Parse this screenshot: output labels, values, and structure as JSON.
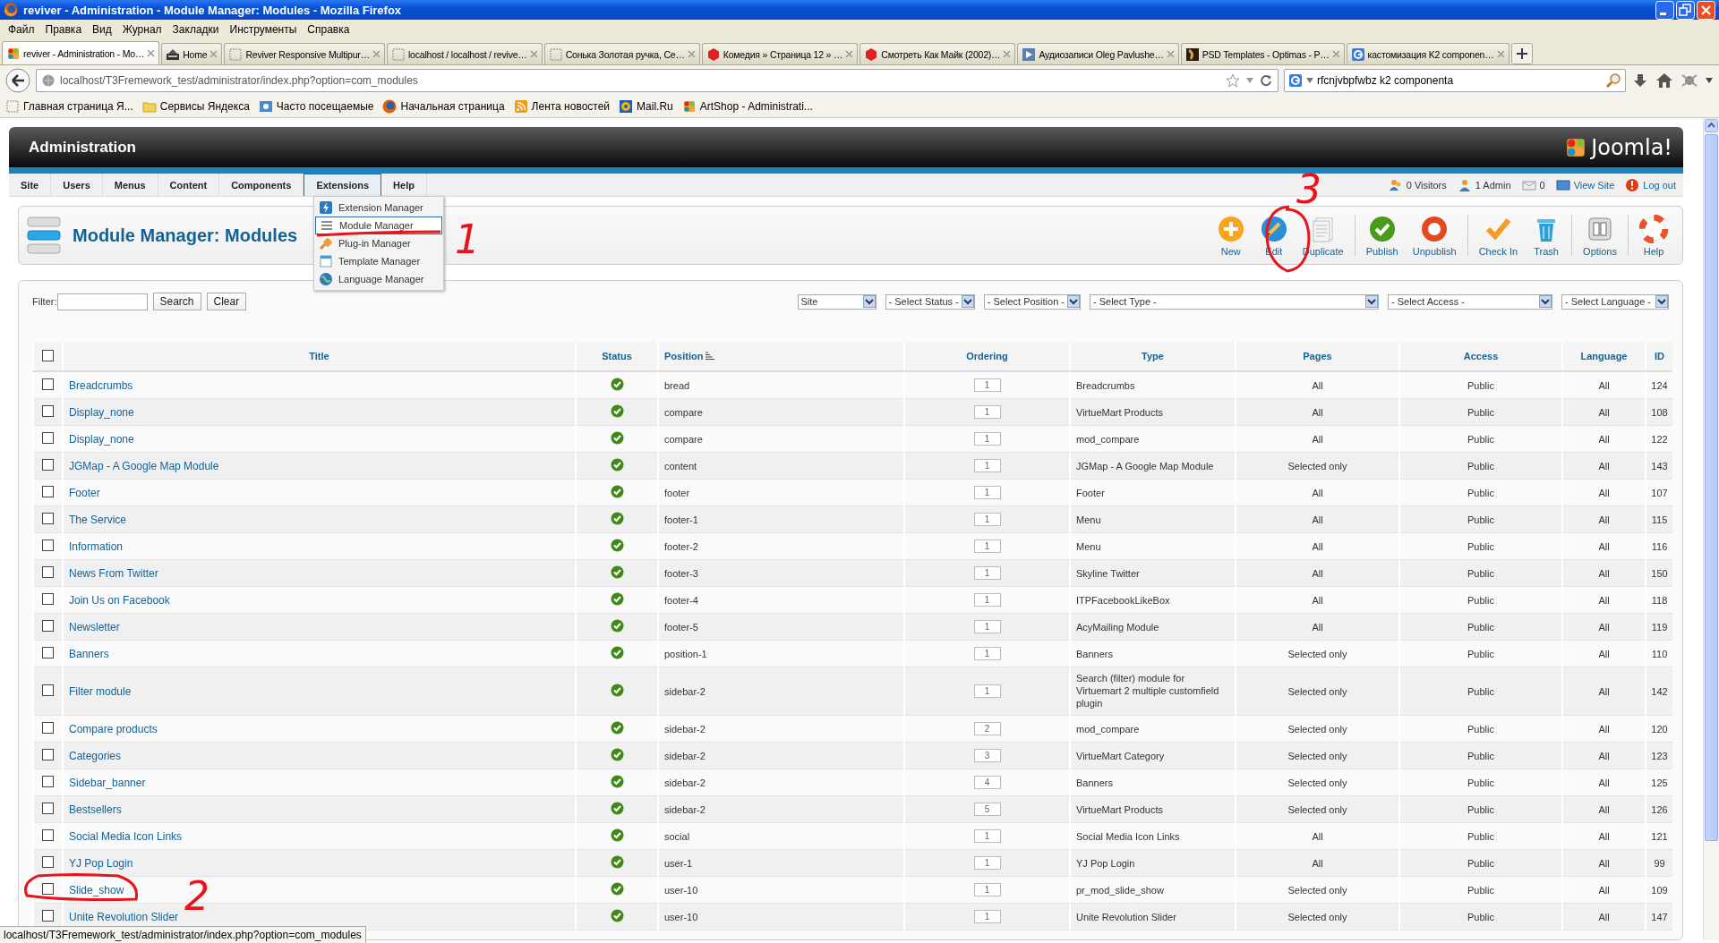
{
  "window": {
    "title": "reviver - Administration - Module Manager: Modules - Mozilla Firefox"
  },
  "menu_bar": [
    "Файл",
    "Правка",
    "Вид",
    "Журнал",
    "Закладки",
    "Инструменты",
    "Справка"
  ],
  "tabs": [
    {
      "label": "reviver - Administration - Mo…",
      "selected": true
    },
    {
      "label": "Home",
      "selected": false
    },
    {
      "label": "Reviver Responsive Multipur…",
      "selected": false
    },
    {
      "label": "localhost / localhost / revive…",
      "selected": false
    },
    {
      "label": "Сонька Золотая ручка, Се…",
      "selected": false
    },
    {
      "label": "Комедия » Страница 12 » …",
      "selected": false
    },
    {
      "label": "Смотреть Как Майк (2002)…",
      "selected": false
    },
    {
      "label": "Аудиозаписи Oleg Pavlushe…",
      "selected": false
    },
    {
      "label": "PSD Templates - Optimas - P…",
      "selected": false
    },
    {
      "label": "кастомизация K2 componen…",
      "selected": false
    }
  ],
  "address": {
    "value": "localhost/T3Fremework_test/administrator/index.php?option=com_modules"
  },
  "search": {
    "value": "rfcnjvbpfwbz k2 componenta"
  },
  "bookmarks": [
    "Главная страница Я...",
    "Сервисы Яндекса",
    "Часто посещаемые",
    "Начальная страница",
    "Лента новостей",
    "Mail.Ru",
    "ArtShop - Administrati..."
  ],
  "admin": {
    "title": "Administration",
    "logo": "Joomla!"
  },
  "admin_menu": [
    {
      "label": "Site",
      "selected": false
    },
    {
      "label": "Users",
      "selected": false
    },
    {
      "label": "Menus",
      "selected": false
    },
    {
      "label": "Content",
      "selected": false
    },
    {
      "label": "Components",
      "selected": false
    },
    {
      "label": "Extensions",
      "selected": true
    },
    {
      "label": "Help",
      "selected": false
    }
  ],
  "status_links": [
    "0 Visitors",
    "1 Admin",
    "0",
    "View Site",
    "Log out"
  ],
  "dropdown": [
    {
      "label": "Extension Manager",
      "selected": false
    },
    {
      "label": "Module Manager",
      "selected": true
    },
    {
      "label": "Plug-in Manager",
      "selected": false
    },
    {
      "label": "Template Manager",
      "selected": false
    },
    {
      "label": "Language Manager",
      "selected": false
    }
  ],
  "page_title": "Module Manager: Modules",
  "toolbar": [
    "New",
    "Edit",
    "Duplicate",
    "Publish",
    "Unpublish",
    "Check In",
    "Trash",
    "Options",
    "Help"
  ],
  "filter": {
    "label": "Filter:",
    "search_button": "Search",
    "clear_button": "Clear"
  },
  "selects": [
    "Site",
    "- Select Status -",
    "- Select Position -",
    "- Select Type -",
    "- Select Access -",
    "- Select Language -"
  ],
  "table": {
    "select_all": false,
    "columns": [
      "Title",
      "Status",
      "Position",
      "Ordering",
      "Type",
      "Pages",
      "Access",
      "Language",
      "ID"
    ],
    "rows": [
      {
        "title": "Breadcrumbs",
        "checked": false,
        "published": true,
        "position": "bread",
        "ordering": "1",
        "type": "Breadcrumbs",
        "pages": "All",
        "access": "Public",
        "language": "All",
        "id": "124"
      },
      {
        "title": "Display_none",
        "checked": false,
        "published": true,
        "position": "compare",
        "ordering": "1",
        "type": "VirtueMart Products",
        "pages": "All",
        "access": "Public",
        "language": "All",
        "id": "108"
      },
      {
        "title": "Display_none",
        "checked": false,
        "published": true,
        "position": "compare",
        "ordering": "1",
        "type": "mod_compare",
        "pages": "All",
        "access": "Public",
        "language": "All",
        "id": "122"
      },
      {
        "title": "JGMap - A Google Map Module",
        "checked": false,
        "published": true,
        "position": "content",
        "ordering": "1",
        "type": "JGMap - A Google Map Module",
        "pages": "Selected only",
        "access": "Public",
        "language": "All",
        "id": "143"
      },
      {
        "title": "Footer",
        "checked": false,
        "published": true,
        "position": "footer",
        "ordering": "1",
        "type": "Footer",
        "pages": "All",
        "access": "Public",
        "language": "All",
        "id": "107"
      },
      {
        "title": "The Service",
        "checked": false,
        "published": true,
        "position": "footer-1",
        "ordering": "1",
        "type": "Menu",
        "pages": "All",
        "access": "Public",
        "language": "All",
        "id": "115"
      },
      {
        "title": "Information",
        "checked": false,
        "published": true,
        "position": "footer-2",
        "ordering": "1",
        "type": "Menu",
        "pages": "All",
        "access": "Public",
        "language": "All",
        "id": "116"
      },
      {
        "title": "News From Twitter",
        "checked": false,
        "published": true,
        "position": "footer-3",
        "ordering": "1",
        "type": "Skyline Twitter",
        "pages": "All",
        "access": "Public",
        "language": "All",
        "id": "150"
      },
      {
        "title": "Join Us on Facebook",
        "checked": false,
        "published": true,
        "position": "footer-4",
        "ordering": "1",
        "type": "ITPFacebookLikeBox",
        "pages": "All",
        "access": "Public",
        "language": "All",
        "id": "118"
      },
      {
        "title": "Newsletter",
        "checked": false,
        "published": true,
        "position": "footer-5",
        "ordering": "1",
        "type": "AcyMailing Module",
        "pages": "All",
        "access": "Public",
        "language": "All",
        "id": "119"
      },
      {
        "title": "Banners",
        "checked": false,
        "published": true,
        "position": "position-1",
        "ordering": "1",
        "type": "Banners",
        "pages": "Selected only",
        "access": "Public",
        "language": "All",
        "id": "110"
      },
      {
        "title": "Filter module",
        "checked": false,
        "published": true,
        "position": "sidebar-2",
        "ordering": "1",
        "type": "Search (filter) module for Virtuemart 2 multiple customfield plugin",
        "pages": "Selected only",
        "access": "Public",
        "language": "All",
        "id": "142"
      },
      {
        "title": "Compare products",
        "checked": false,
        "published": true,
        "position": "sidebar-2",
        "ordering": "2",
        "type": "mod_compare",
        "pages": "Selected only",
        "access": "Public",
        "language": "All",
        "id": "120"
      },
      {
        "title": "Categories",
        "checked": false,
        "published": true,
        "position": "sidebar-2",
        "ordering": "3",
        "type": "VirtueMart Category",
        "pages": "Selected only",
        "access": "Public",
        "language": "All",
        "id": "123"
      },
      {
        "title": "Sidebar_banner",
        "checked": false,
        "published": true,
        "position": "sidebar-2",
        "ordering": "4",
        "type": "Banners",
        "pages": "Selected only",
        "access": "Public",
        "language": "All",
        "id": "125"
      },
      {
        "title": "Bestsellers",
        "checked": false,
        "published": true,
        "position": "sidebar-2",
        "ordering": "5",
        "type": "VirtueMart Products",
        "pages": "Selected only",
        "access": "Public",
        "language": "All",
        "id": "126"
      },
      {
        "title": "Social Media Icon Links",
        "checked": false,
        "published": true,
        "position": "social",
        "ordering": "1",
        "type": "Social Media Icon Links",
        "pages": "All",
        "access": "Public",
        "language": "All",
        "id": "121"
      },
      {
        "title": "YJ Pop Login",
        "checked": false,
        "published": true,
        "position": "user-1",
        "ordering": "1",
        "type": "YJ Pop Login",
        "pages": "All",
        "access": "Public",
        "language": "All",
        "id": "99"
      },
      {
        "title": "Slide_show",
        "checked": false,
        "published": true,
        "position": "user-10",
        "ordering": "1",
        "type": "pr_mod_slide_show",
        "pages": "Selected only",
        "access": "Public",
        "language": "All",
        "id": "109"
      },
      {
        "title": "Unite Revolution Slider",
        "checked": false,
        "published": true,
        "position": "user-10",
        "ordering": "1",
        "type": "Unite Revolution Slider",
        "pages": "Selected only",
        "access": "Public",
        "language": "All",
        "id": "147"
      }
    ]
  },
  "annotations": [
    "1",
    "2",
    "3"
  ],
  "status_bar": {
    "text": "localhost/T3Fremework_test/administrator/index.php?option=com_modules"
  }
}
